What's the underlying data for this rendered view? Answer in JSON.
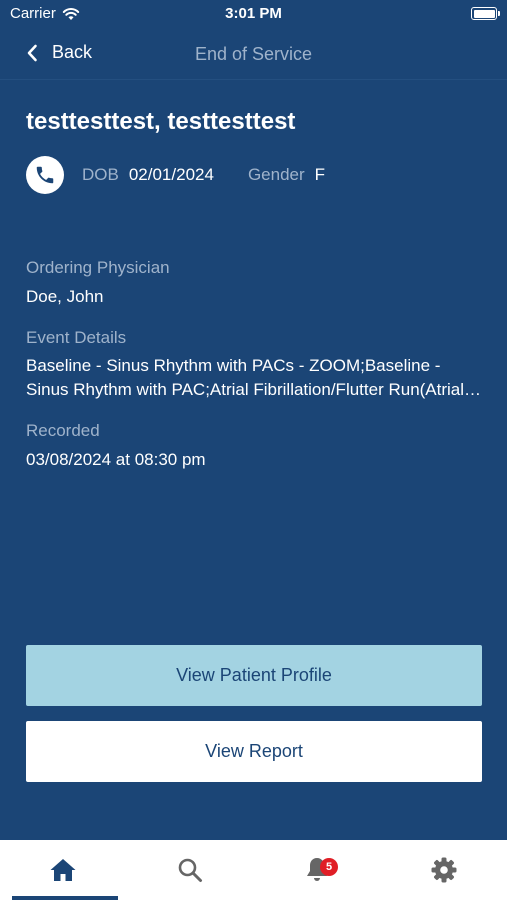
{
  "status_bar": {
    "carrier": "Carrier",
    "time": "3:01 PM"
  },
  "nav": {
    "back_label": "Back",
    "title": "End of Service"
  },
  "patient": {
    "name": "testtesttest, testtesttest",
    "dob_label": "DOB",
    "dob_value": "02/01/2024",
    "gender_label": "Gender",
    "gender_value": "F"
  },
  "fields": {
    "ordering_physician_label": "Ordering Physician",
    "ordering_physician_value": "Doe, John",
    "event_details_label": "Event Details",
    "event_details_value": "Baseline - Sinus Rhythm with PACs - ZOOM;Baseline - Sinus Rhythm with PAC;Atrial Fibrillation/Flutter Run(Atrial Fibrillation/Flutter Run)",
    "recorded_label": "Recorded",
    "recorded_value": "03/08/2024 at 08:30 pm"
  },
  "actions": {
    "view_patient_profile": "View Patient Profile",
    "view_report": "View Report"
  },
  "tab_bar": {
    "tabs": [
      {
        "icon": "home-icon",
        "active": true
      },
      {
        "icon": "search-icon",
        "active": false
      },
      {
        "icon": "bell-icon",
        "active": false,
        "badge": "5"
      },
      {
        "icon": "gear-icon",
        "active": false
      }
    ],
    "notification_badge": "5"
  },
  "colors": {
    "background": "#1b4576",
    "primary_button": "#a3d3e2",
    "muted_text": "#9fb3cb",
    "badge": "#e01e26"
  }
}
